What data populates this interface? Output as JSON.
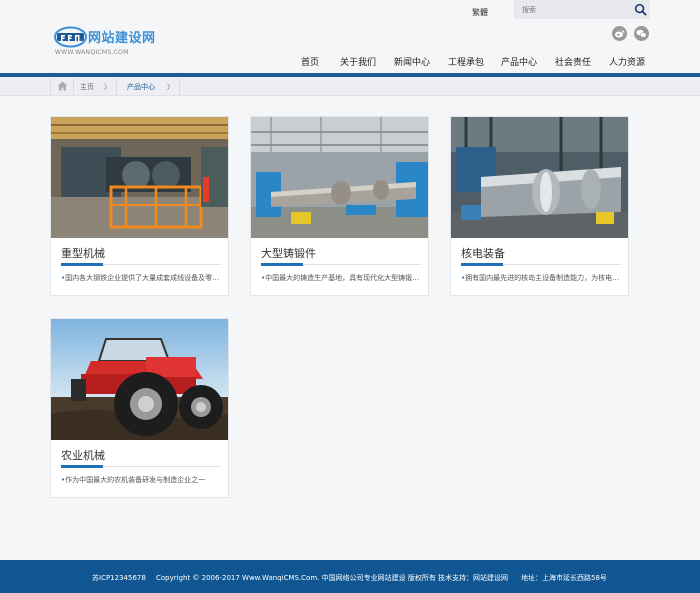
{
  "header": {
    "lang_switch": "繁體",
    "search": {
      "placeholder": "搜索"
    },
    "logo": {
      "text": "网站建设网",
      "url_text": "WWW.WANQICMS.COM"
    },
    "social": [
      "weibo-icon",
      "wechat-icon"
    ]
  },
  "nav": {
    "items": [
      {
        "label": "首页"
      },
      {
        "label": "关于我们"
      },
      {
        "label": "新闻中心"
      },
      {
        "label": "工程承包"
      },
      {
        "label": "产品中心"
      },
      {
        "label": "社会责任"
      },
      {
        "label": "人力资源"
      }
    ]
  },
  "breadcrumb": {
    "home": "主页",
    "current": "产品中心",
    "sep": "〉"
  },
  "products": [
    {
      "title": "重型机械",
      "desc": "国内各大钢铁企业提供了大量成套成线设备及零部件"
    },
    {
      "title": "大型铸锻件",
      "desc": "中国最大的铸造生产基地，具有现代化大型铸锻件生产能力"
    },
    {
      "title": "核电装备",
      "desc": "拥有国内最先进的核岛主设备制造能力，为核电事业提供装备"
    },
    {
      "title": "农业机械",
      "desc": "作为中国最大的农机装备研发与制造企业之一"
    }
  ],
  "footer": {
    "icp": "苏ICP12345678",
    "copyright": "Copyright © 2006-2017 Www.WanqiCMS.Com. 中国网络公司专业网站建设 版权所有 技术支持：网站建设网",
    "address": "地址：上海市延长西路58号"
  },
  "colors": {
    "primary": "#1d5a96",
    "accent": "#1d6fb8",
    "footer": "#0f5693",
    "logo": "#3c8fd6"
  }
}
